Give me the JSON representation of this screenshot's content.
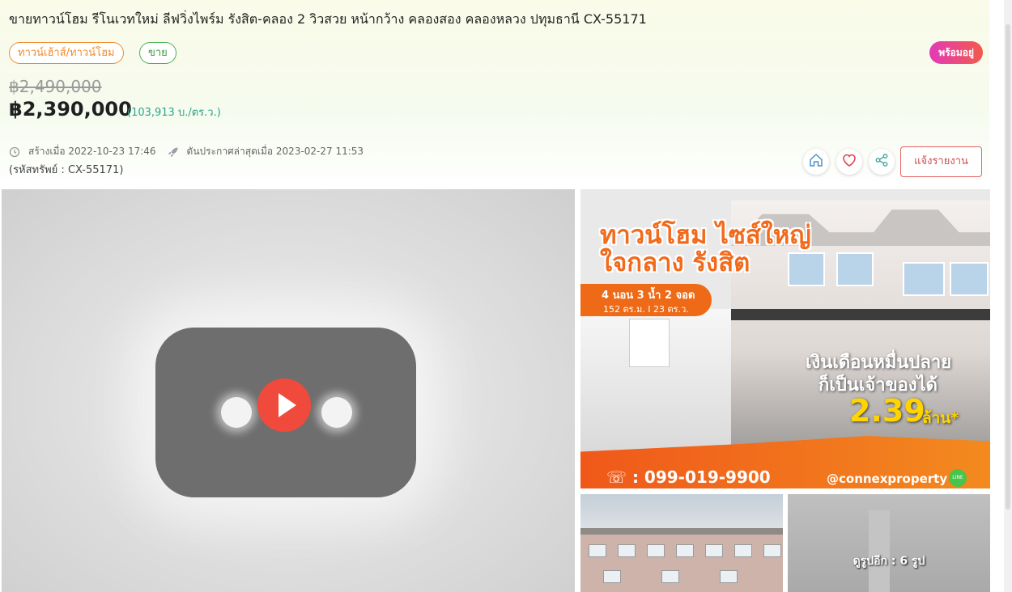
{
  "listing": {
    "title": "ขายทาวน์โฮม รีโนเวทใหม่ ลีฟวิ่งไพร์ม รังสิต-คลอง 2 วิวสวย หน้ากว้าง คลองสอง คลองหลวง ปทุมธานี CX-55171",
    "type_chip": "ทาวน์เฮ้าส์/ทาวน์โฮม",
    "sale_chip": "ขาย",
    "status_badge": "พร้อมอยู่",
    "old_price": "฿2,490,000",
    "price": "฿2,390,000",
    "price_per_sqwa": "(103,913 บ./ตร.ว.)",
    "created_label": "สร้างเมื่อ 2022-10-23 17:46",
    "pushed_label": "ดันประกาศล่าสุดเมื่อ 2023-02-27 11:53",
    "code": "(รหัสทรัพย์ : CX-55171)",
    "report_label": "แจ้งรายงาน"
  },
  "icons": {
    "created": "clock-icon",
    "pushed": "rocket-icon",
    "home": "home-icon",
    "favorite": "heart-icon",
    "share": "share-icon",
    "video": "play-icon"
  },
  "gallery": {
    "promo": {
      "headline_1": "ทาวน์โฮม ไซส์ใหญ่",
      "headline_2": "ใจกลาง รังสิต",
      "specs": "4 นอน 3 น้ำ 2 จอด",
      "area": "152 ตร.ม. I 23 ตร.ว.",
      "cta_1": "เงินเดือนหมื่นปลาย",
      "cta_2": "ก็เป็นเจ้าของได้",
      "price": "2.39",
      "price_unit": "ล้าน*",
      "phone": "☏ : 099-019-9900",
      "line_id": "@connexproperty",
      "line_badge": "LINE"
    },
    "more_photos": "ดูรูปอีก : 6 รูป"
  },
  "colors": {
    "type_chip": "#ef8b2c",
    "sale_chip": "#4caf50",
    "badge_start": "#e33ab8",
    "badge_end": "#f25a4a",
    "price_per_sqwa": "#2ea38a",
    "report": "#d24e4e",
    "play": "#f04a3c",
    "promo_orange": "#f26a1b",
    "promo_price": "#ffd400"
  }
}
